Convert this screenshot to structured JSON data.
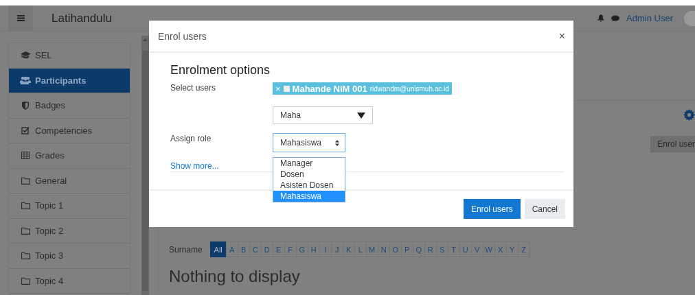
{
  "navbar": {
    "site_name": "Latihandulu",
    "user_name": "Admin User"
  },
  "sidebar": {
    "items": [
      {
        "label": "SEL",
        "kind": "course",
        "selected": false
      },
      {
        "label": "Participants",
        "kind": "participants",
        "selected": true
      },
      {
        "label": "Badges",
        "kind": "badges",
        "selected": false
      },
      {
        "label": "Competencies",
        "kind": "competencies",
        "selected": false
      },
      {
        "label": "Grades",
        "kind": "grades",
        "selected": false
      },
      {
        "label": "General",
        "kind": "section",
        "selected": false
      },
      {
        "label": "Topic 1",
        "kind": "section",
        "selected": false
      },
      {
        "label": "Topic 2",
        "kind": "section",
        "selected": false
      },
      {
        "label": "Topic 3",
        "kind": "section",
        "selected": false
      },
      {
        "label": "Topic 4",
        "kind": "section",
        "selected": false
      }
    ]
  },
  "page": {
    "enrol_button": "Enrol user",
    "surname_filter": {
      "label": "Surname",
      "letters": [
        {
          "label": "All",
          "selected": true
        },
        {
          "label": "A",
          "selected": false
        },
        {
          "label": "B",
          "selected": false
        },
        {
          "label": "C",
          "selected": false
        },
        {
          "label": "D",
          "selected": false
        },
        {
          "label": "E",
          "selected": false
        },
        {
          "label": "F",
          "selected": false
        },
        {
          "label": "G",
          "selected": false
        },
        {
          "label": "H",
          "selected": false
        },
        {
          "label": "I",
          "selected": false
        },
        {
          "label": "J",
          "selected": false
        },
        {
          "label": "K",
          "selected": false
        },
        {
          "label": "L",
          "selected": false
        },
        {
          "label": "M",
          "selected": false
        },
        {
          "label": "N",
          "selected": false
        },
        {
          "label": "O",
          "selected": false
        },
        {
          "label": "P",
          "selected": false
        },
        {
          "label": "Q",
          "selected": false
        },
        {
          "label": "R",
          "selected": false
        },
        {
          "label": "S",
          "selected": false
        },
        {
          "label": "T",
          "selected": false
        },
        {
          "label": "U",
          "selected": false
        },
        {
          "label": "V",
          "selected": false
        },
        {
          "label": "W",
          "selected": false
        },
        {
          "label": "X",
          "selected": false
        },
        {
          "label": "Y",
          "selected": false
        },
        {
          "label": "Z",
          "selected": false
        }
      ]
    },
    "empty_message": "Nothing to display"
  },
  "dialog": {
    "title": "Enrol users",
    "close": "×",
    "heading": "Enrolment options",
    "select_users_label": "Select users",
    "selected_user": {
      "remove": "×",
      "name": "Mahande NIM 001",
      "email": "ridwandm@unismuh.ac.id"
    },
    "search_value": "Maha",
    "assign_role_label": "Assign role",
    "role_value": "Mahasiswa",
    "role_options": [
      {
        "label": "Manager",
        "selected": false
      },
      {
        "label": "Dosen",
        "selected": false
      },
      {
        "label": "Asisten Dosen",
        "selected": false
      },
      {
        "label": "Mahasiswa",
        "selected": true
      }
    ],
    "show_more": "Show more...",
    "buttons": [
      {
        "label": "Enrol users",
        "kind": "primary"
      },
      {
        "label": "Cancel",
        "kind": "secondary"
      }
    ]
  }
}
